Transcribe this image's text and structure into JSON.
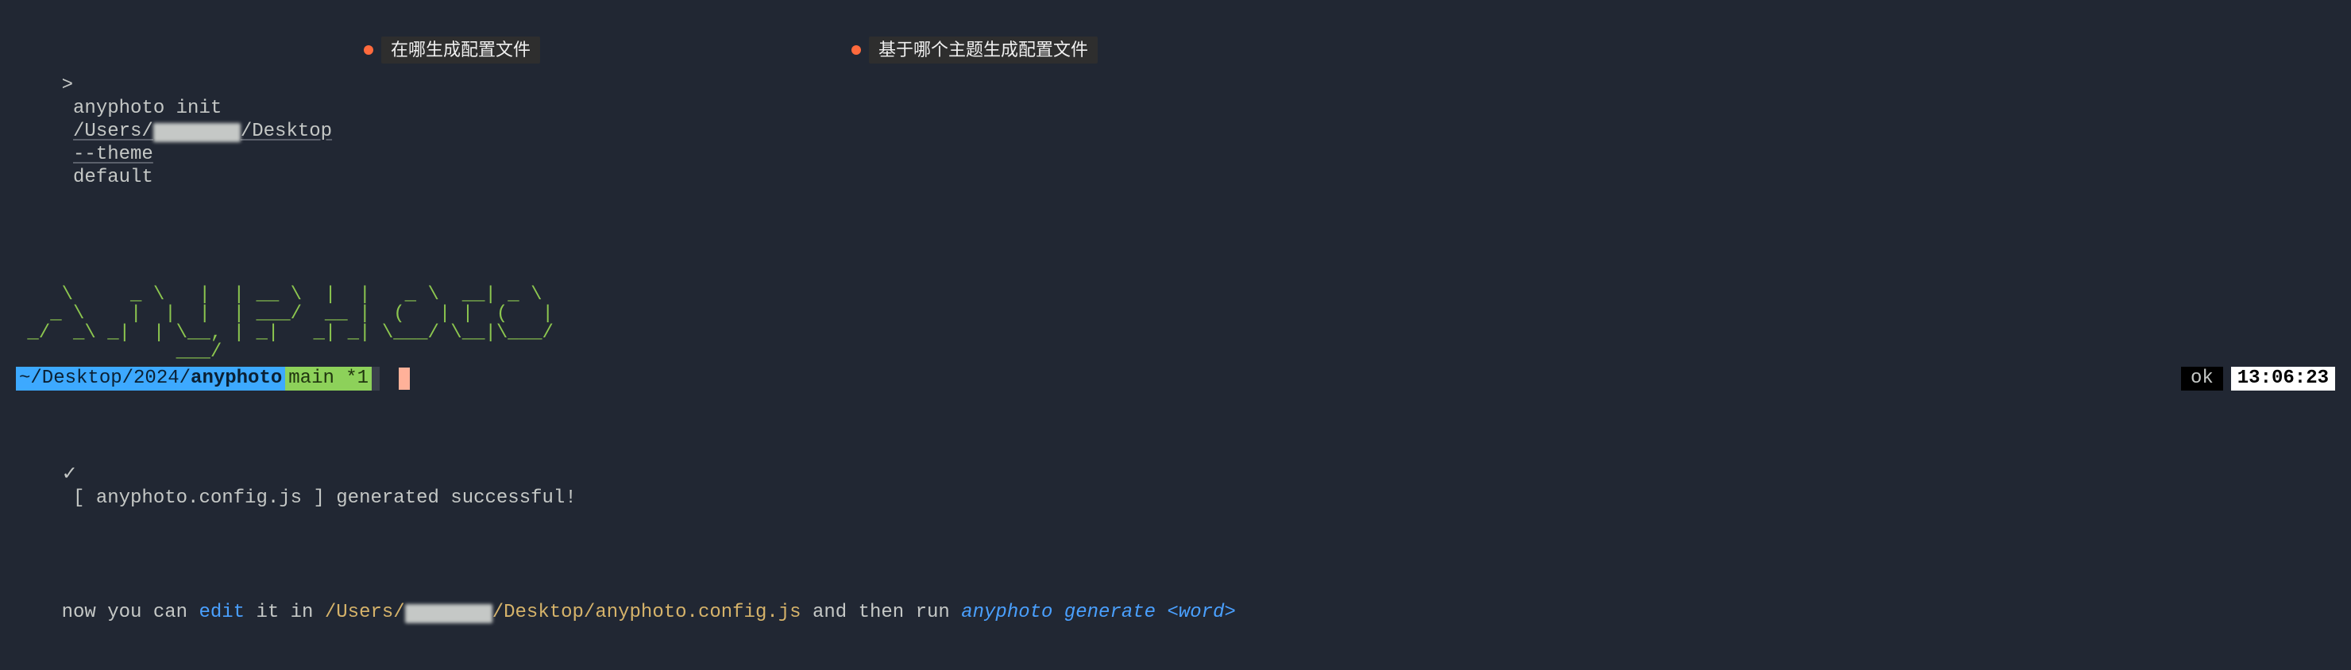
{
  "prompt": {
    "symbol": ">",
    "command": "anyphoto init",
    "path_prefix": "/Users/",
    "path_suffix": "/Desktop",
    "flag": "--theme",
    "flag_value": "default"
  },
  "annotations": {
    "a1": "在哪生成配置文件",
    "a2": "基于哪个主题生成配置文件"
  },
  "ascii_art": "    \\     _ \\   |  | __ \\  |  |   _ \\  __| _ \\\n   _ \\    |  |  |  | ___/  __ |  (   | |  (   |\n _/  _\\ _|  | \\__, | _|   _| _| \\___/ \\__|\\___/\n              ___/",
  "success": {
    "check": "✓",
    "line": "[ anyphoto.config.js ] generated successful!"
  },
  "hint": {
    "prefix": "now you can ",
    "edit_kw": "edit",
    "mid1": " it in ",
    "path_prefix": "/Users/",
    "path_suffix": "/Desktop/anyphoto.config.js",
    "mid2": " and then run ",
    "run_kw": "anyphoto generate <word>"
  },
  "status": {
    "path_prefix": "~/Desktop/2024/",
    "path_bold": "anyphoto",
    "branch": "main *1",
    "ok": "ok",
    "time": "13:06:23"
  }
}
